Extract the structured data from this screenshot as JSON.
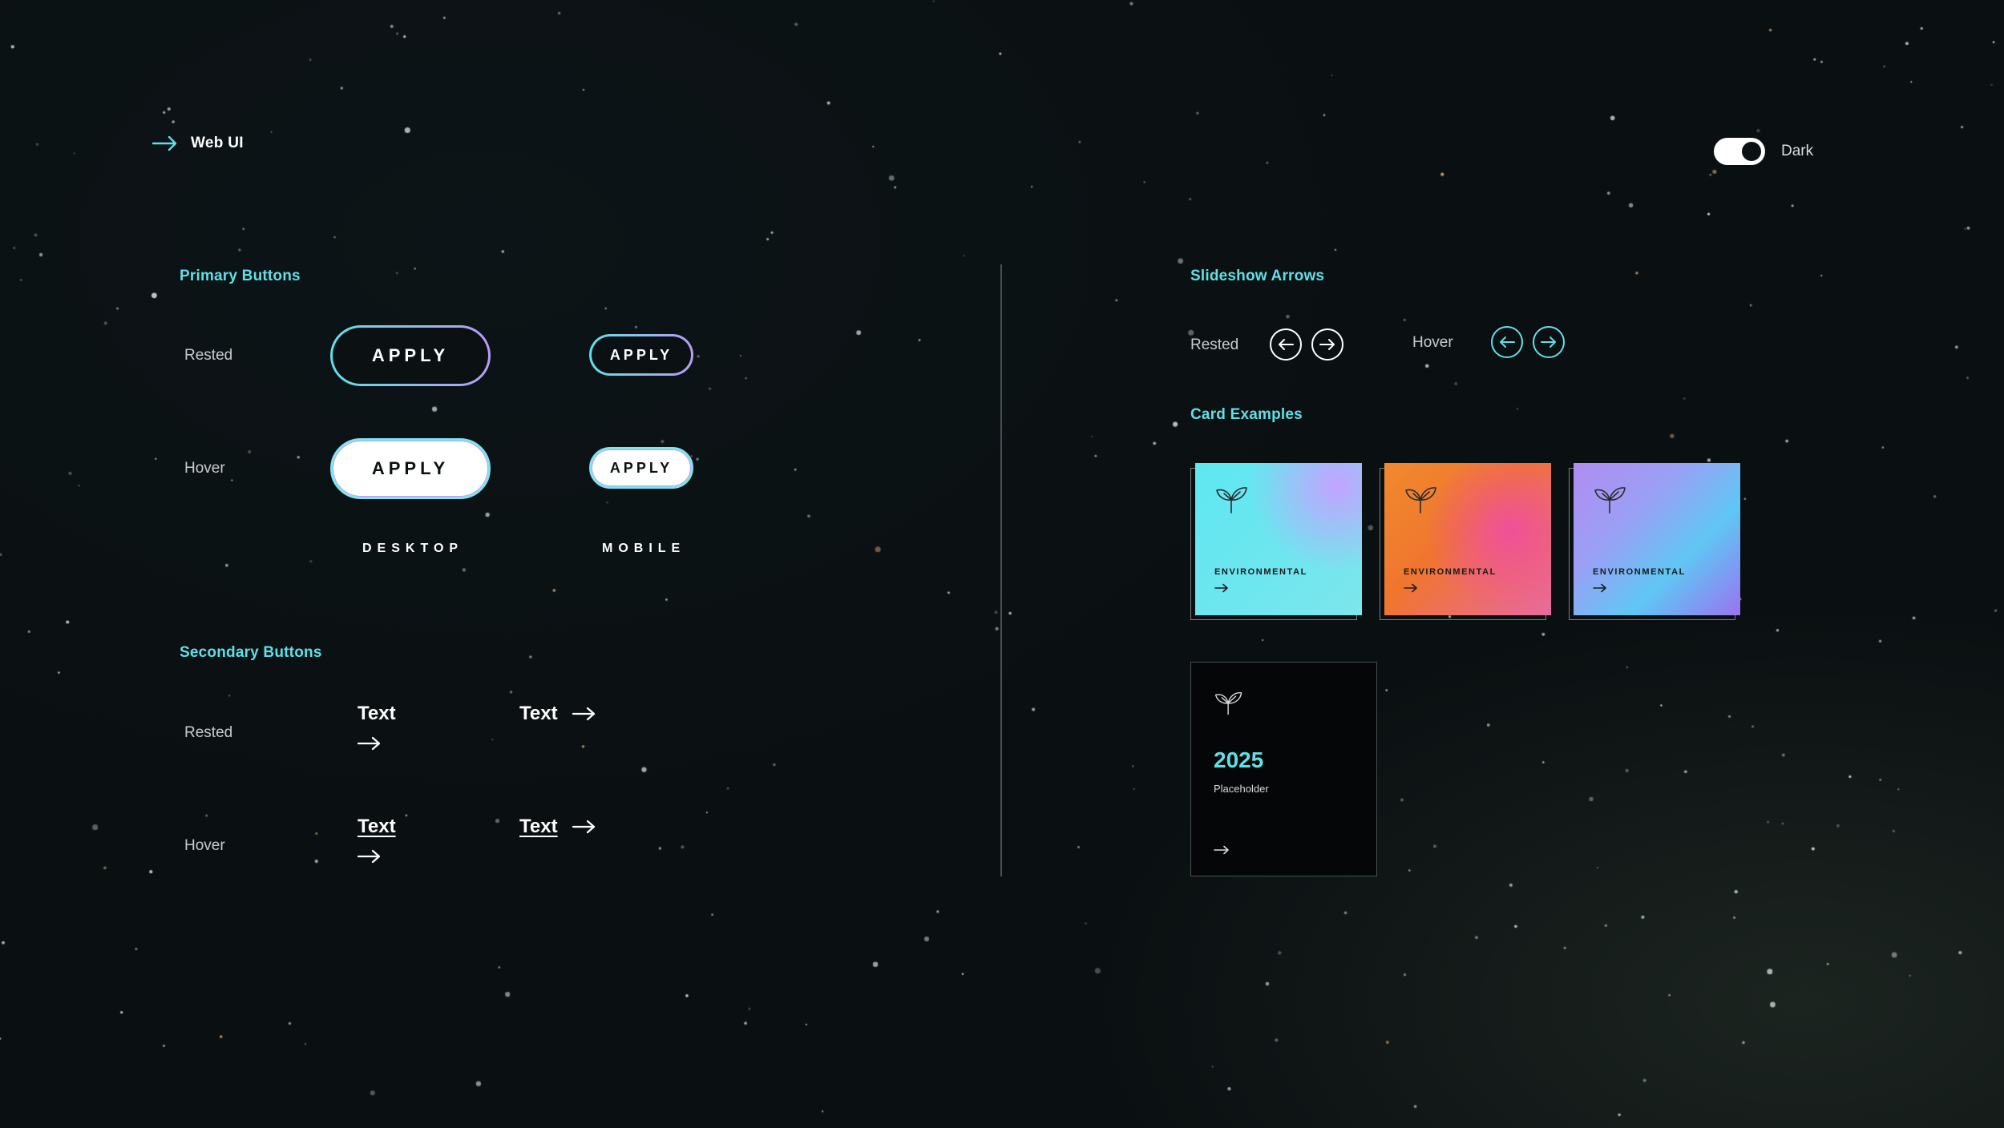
{
  "header": {
    "title": "Web UI"
  },
  "theme_toggle": {
    "label": "Dark",
    "state": "on"
  },
  "primary_buttons": {
    "title": "Primary Buttons",
    "rows": {
      "rested": "Rested",
      "hover": "Hover"
    },
    "button_label": "APPLY",
    "sizes": {
      "desktop": "DESKTOP",
      "mobile": "MOBILE"
    }
  },
  "secondary_buttons": {
    "title": "Secondary Buttons",
    "rows": {
      "rested": "Rested",
      "hover": "Hover"
    },
    "button_text": "Text"
  },
  "slideshow_arrows": {
    "title": "Slideshow Arrows",
    "rested": "Rested",
    "hover": "Hover"
  },
  "cards": {
    "title": "Card Examples",
    "items": [
      {
        "tag": "ENVIRONMENTAL",
        "icon": "leaf-icon"
      },
      {
        "tag": "ENVIRONMENTAL",
        "icon": "leaf-icon"
      },
      {
        "tag": "ENVIRONMENTAL",
        "icon": "leaf-icon"
      }
    ],
    "dark_card": {
      "year": "2025",
      "subtitle": "Placeholder",
      "icon": "leaf-icon"
    }
  },
  "colors": {
    "accent": "#5fe0e6",
    "accent_purple": "#b99cf5",
    "background": "#0b1113"
  }
}
